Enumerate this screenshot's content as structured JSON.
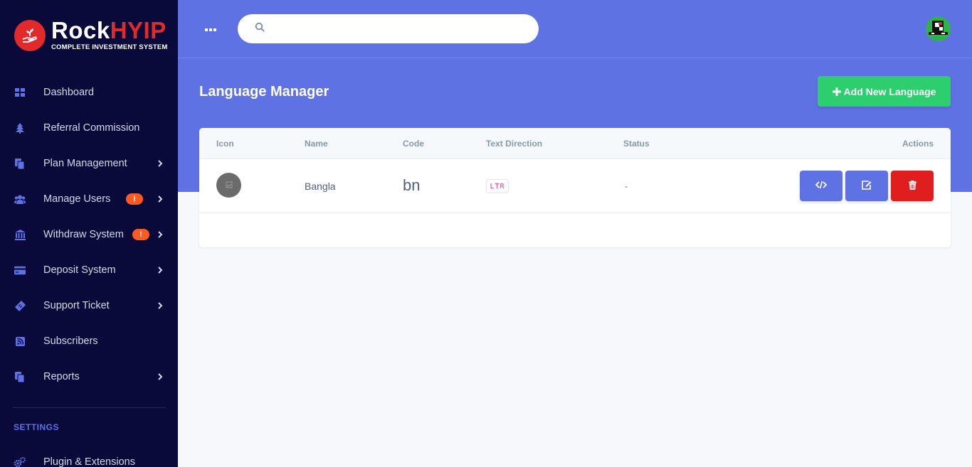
{
  "brand": {
    "name_part1": "Rock",
    "name_part2": "HYIP",
    "tagline": "COMPLETE INVESTMENT SYSTEM"
  },
  "sidebar": {
    "items": [
      {
        "label": "Dashboard",
        "icon": "dashboard-icon"
      },
      {
        "label": "Referral Commission",
        "icon": "tree-icon"
      },
      {
        "label": "Plan Management",
        "icon": "copy-icon"
      },
      {
        "label": "Manage Users",
        "icon": "users-icon",
        "badge": "!"
      },
      {
        "label": "Withdraw System",
        "icon": "bank-icon",
        "badge": "!"
      },
      {
        "label": "Deposit System",
        "icon": "credit-card-icon"
      },
      {
        "label": "Support Ticket",
        "icon": "ticket-icon"
      },
      {
        "label": "Subscribers",
        "icon": "rss-icon"
      },
      {
        "label": "Reports",
        "icon": "copy-icon"
      }
    ],
    "settings_heading": "SETTINGS",
    "plugin_label": "Plugin & Extensions"
  },
  "topbar": {
    "search_placeholder": ""
  },
  "page": {
    "title": "Language Manager",
    "add_button_label": "Add New Language"
  },
  "table": {
    "headers": [
      "Icon",
      "Name",
      "Code",
      "Text Direction",
      "Status",
      "Actions"
    ],
    "rows": [
      {
        "name": "Bangla",
        "code": "bn",
        "direction": "LTR",
        "status": "-"
      }
    ]
  },
  "colors": {
    "sidebar_bg": "#0a0a3a",
    "primary": "#5e72e4",
    "success": "#2dce6e",
    "danger": "#e01e1e",
    "brand_red": "#e22a2a",
    "badge_orange": "#ff5a1f"
  }
}
